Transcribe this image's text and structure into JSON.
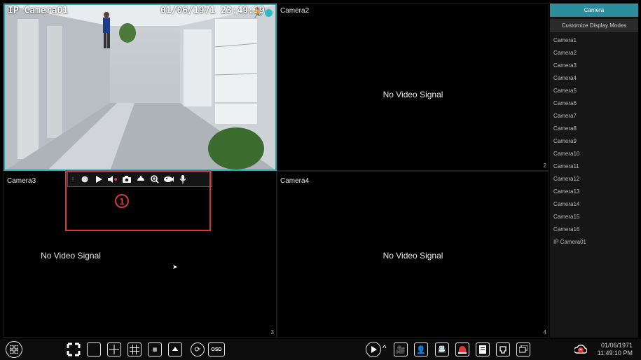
{
  "cells": [
    {
      "title": "",
      "osd_name": "IP Camera01",
      "osd_datetime": "01/06/1971 23:49:19",
      "number": ""
    },
    {
      "title": "Camera2",
      "message": "No Video Signal",
      "number": "2"
    },
    {
      "title": "Camera3",
      "message": "No Video Signal",
      "number": "3"
    },
    {
      "title": "Camera4",
      "message": "No Video Signal",
      "number": "4"
    }
  ],
  "marker": {
    "label": "1"
  },
  "toolbar": {
    "icons": [
      "drag-handle-icon",
      "record-icon",
      "play-icon",
      "audio-icon",
      "snapshot-icon",
      "preset-icon",
      "zoom-icon",
      "ptz-icon",
      "talk-icon"
    ],
    "glyphs": [
      "⋮⋮",
      "●",
      "▶",
      "◀•",
      "📷",
      "⏏",
      "⊕",
      "🐟",
      "🎤"
    ]
  },
  "side": {
    "tab_camera": "Camera",
    "tab_custom": "Customize Display Modes",
    "items": [
      "Camera1",
      "Camera2",
      "Camera3",
      "Camera4",
      "Camera5",
      "Camera6",
      "Camera7",
      "Camera8",
      "Camera9",
      "Camera10",
      "Camera11",
      "Camera12",
      "Camera13",
      "Camera14",
      "Camera15",
      "Camera16",
      "IP Camera01"
    ]
  },
  "bottom": {
    "osd_label": "OSD",
    "date": "01/06/1971",
    "time": "11:49:10 PM"
  },
  "colors": {
    "accent": "#2c8d9d",
    "highlight": "#d9363e"
  }
}
